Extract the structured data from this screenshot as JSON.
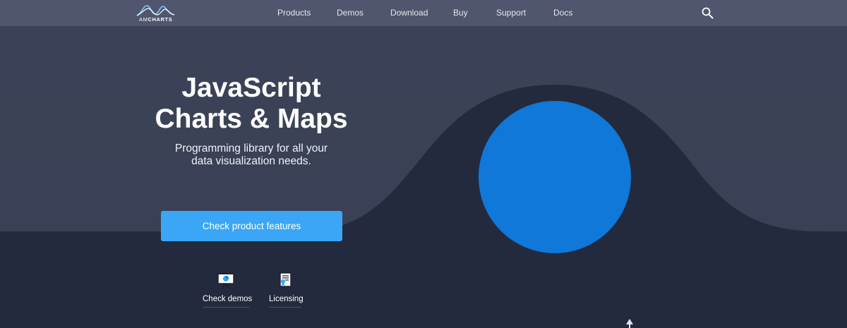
{
  "brand": {
    "logo_light": "AM",
    "logo_bold": "CHARTS"
  },
  "nav": {
    "items": [
      "Products",
      "Demos",
      "Download",
      "Buy",
      "Support",
      "Docs"
    ],
    "search_icon": "search-icon"
  },
  "hero": {
    "title_line1": "JavaScript",
    "title_line2": "Charts & Maps",
    "subtitle_line1": "Programming library for all your",
    "subtitle_line2": "data visualization needs.",
    "cta_label": "Check product features"
  },
  "links": {
    "demos_label": "Check demos",
    "demos_icon": "presentation-board-icon",
    "licensing_label": "Licensing",
    "licensing_icon": "license-document-icon"
  },
  "colors": {
    "nav_bg": "#50566d",
    "hero_upper": "#3b4257",
    "hero_lower": "#242a3d",
    "cta_bg": "#3aa6f5",
    "circle": "#0f78d8"
  }
}
